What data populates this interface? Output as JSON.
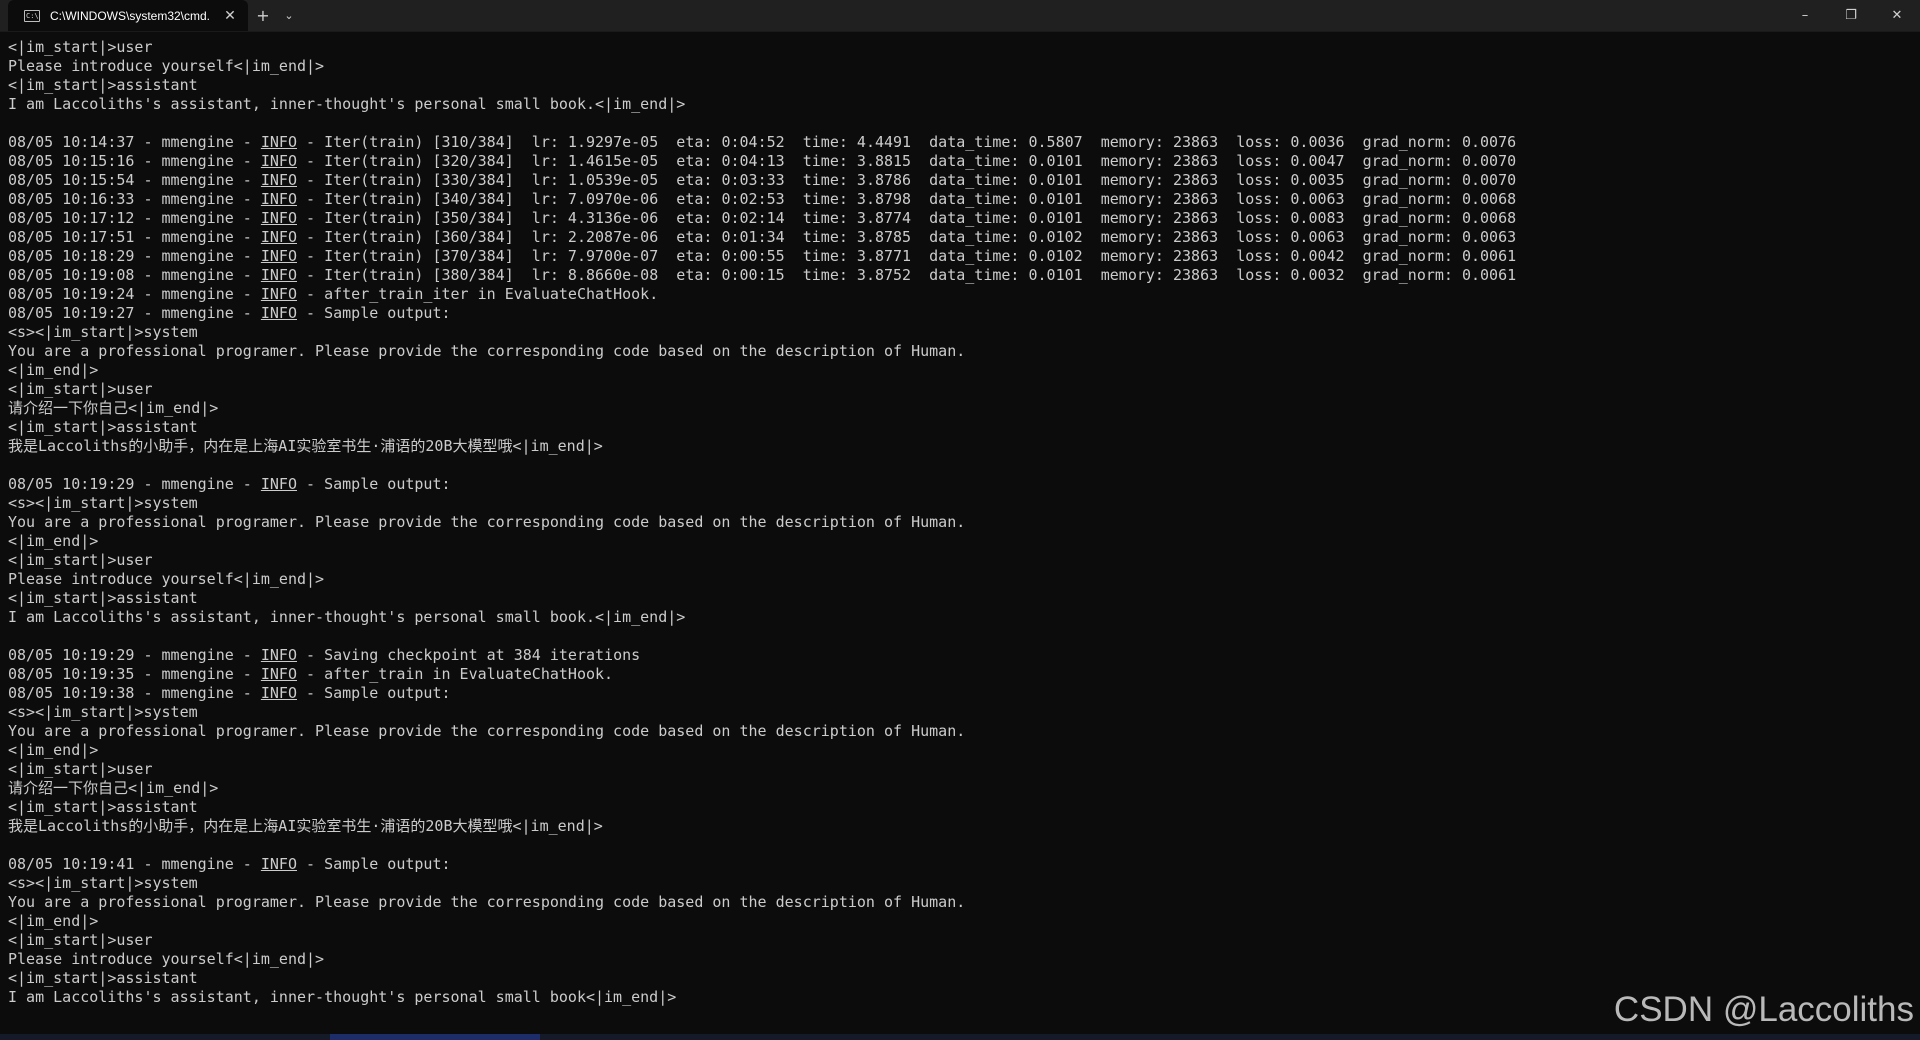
{
  "window": {
    "tab_title": "C:\\WINDOWS\\system32\\cmd.",
    "tab_icon": "C:\\",
    "new_tab_label": "+",
    "dropdown_label": "⌄",
    "minimize_label": "–",
    "maximize_label": "❐",
    "close_label": "✕"
  },
  "terminal": {
    "lines": [
      "<|im_start|>user",
      "Please introduce yourself<|im_end|>",
      "<|im_start|>assistant",
      "I am Laccoliths's assistant, inner-thought's personal small book.<|im_end|>",
      "",
      "08/05 10:14:37 - mmengine - INFO - Iter(train) [310/384]  lr: 1.9297e-05  eta: 0:04:52  time: 4.4491  data_time: 0.5807  memory: 23863  loss: 0.0036  grad_norm: 0.0076",
      "08/05 10:15:16 - mmengine - INFO - Iter(train) [320/384]  lr: 1.4615e-05  eta: 0:04:13  time: 3.8815  data_time: 0.0101  memory: 23863  loss: 0.0047  grad_norm: 0.0070",
      "08/05 10:15:54 - mmengine - INFO - Iter(train) [330/384]  lr: 1.0539e-05  eta: 0:03:33  time: 3.8786  data_time: 0.0101  memory: 23863  loss: 0.0035  grad_norm: 0.0070",
      "08/05 10:16:33 - mmengine - INFO - Iter(train) [340/384]  lr: 7.0970e-06  eta: 0:02:53  time: 3.8798  data_time: 0.0101  memory: 23863  loss: 0.0063  grad_norm: 0.0068",
      "08/05 10:17:12 - mmengine - INFO - Iter(train) [350/384]  lr: 4.3136e-06  eta: 0:02:14  time: 3.8774  data_time: 0.0101  memory: 23863  loss: 0.0083  grad_norm: 0.0068",
      "08/05 10:17:51 - mmengine - INFO - Iter(train) [360/384]  lr: 2.2087e-06  eta: 0:01:34  time: 3.8785  data_time: 0.0102  memory: 23863  loss: 0.0063  grad_norm: 0.0063",
      "08/05 10:18:29 - mmengine - INFO - Iter(train) [370/384]  lr: 7.9700e-07  eta: 0:00:55  time: 3.8771  data_time: 0.0102  memory: 23863  loss: 0.0042  grad_norm: 0.0061",
      "08/05 10:19:08 - mmengine - INFO - Iter(train) [380/384]  lr: 8.8660e-08  eta: 0:00:15  time: 3.8752  data_time: 0.0101  memory: 23863  loss: 0.0032  grad_norm: 0.0061",
      "08/05 10:19:24 - mmengine - INFO - after_train_iter in EvaluateChatHook.",
      "08/05 10:19:27 - mmengine - INFO - Sample output:",
      "<s><|im_start|>system",
      "You are a professional programer. Please provide the corresponding code based on the description of Human.",
      "<|im_end|>",
      "<|im_start|>user",
      "请介绍一下你自己<|im_end|>",
      "<|im_start|>assistant",
      "我是Laccoliths的小助手，内在是上海AI实验室书生·浦语的20B大模型哦<|im_end|>",
      "",
      "08/05 10:19:29 - mmengine - INFO - Sample output:",
      "<s><|im_start|>system",
      "You are a professional programer. Please provide the corresponding code based on the description of Human.",
      "<|im_end|>",
      "<|im_start|>user",
      "Please introduce yourself<|im_end|>",
      "<|im_start|>assistant",
      "I am Laccoliths's assistant, inner-thought's personal small book.<|im_end|>",
      "",
      "08/05 10:19:29 - mmengine - INFO - Saving checkpoint at 384 iterations",
      "08/05 10:19:35 - mmengine - INFO - after_train in EvaluateChatHook.",
      "08/05 10:19:38 - mmengine - INFO - Sample output:",
      "<s><|im_start|>system",
      "You are a professional programer. Please provide the corresponding code based on the description of Human.",
      "<|im_end|>",
      "<|im_start|>user",
      "请介绍一下你自己<|im_end|>",
      "<|im_start|>assistant",
      "我是Laccoliths的小助手，内在是上海AI实验室书生·浦语的20B大模型哦<|im_end|>",
      "",
      "08/05 10:19:41 - mmengine - INFO - Sample output:",
      "<s><|im_start|>system",
      "You are a professional programer. Please provide the corresponding code based on the description of Human.",
      "<|im_end|>",
      "<|im_start|>user",
      "Please introduce yourself<|im_end|>",
      "<|im_start|>assistant",
      "I am Laccoliths's assistant, inner-thought's personal small book<|im_end|>"
    ]
  },
  "watermark": {
    "text": "CSDN @Laccoliths"
  },
  "colors": {
    "background": "#0c0c0c",
    "foreground": "#cccccc",
    "titlebar": "#202020"
  }
}
